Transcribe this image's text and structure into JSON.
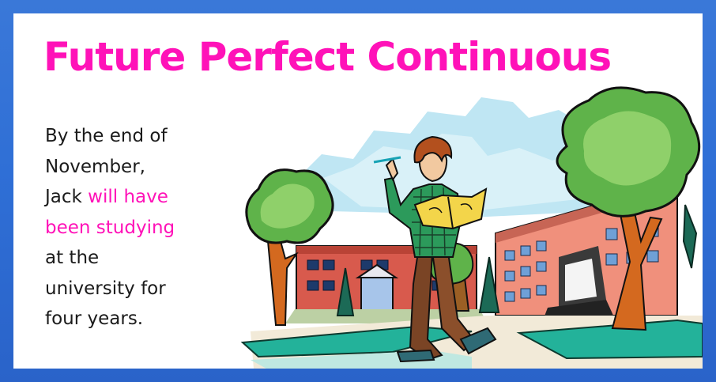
{
  "slide": {
    "title": "Future Perfect Continuous",
    "sentence": {
      "line1": "By the end of",
      "line2": "November,",
      "line3_prefix": "Jack ",
      "line3_highlight": "will have",
      "line4_highlight": "been studying",
      "line5": "at the",
      "line6": "university for",
      "line7": "four years."
    }
  },
  "colors": {
    "frame": "#2f6fd6",
    "title": "#ff12b8",
    "highlight": "#ff12b8",
    "text": "#1b1b1b"
  },
  "illustration": {
    "subject": "student-reading-book-on-campus"
  }
}
